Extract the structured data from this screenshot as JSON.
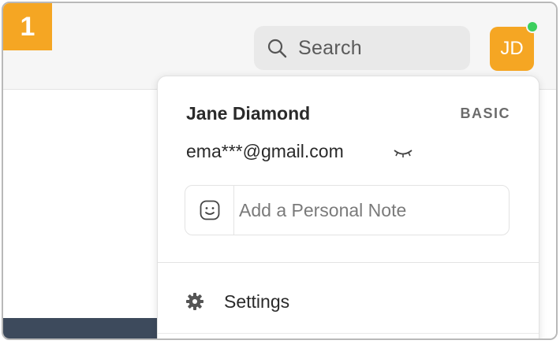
{
  "step": {
    "number": "1",
    "color": "#f5a623"
  },
  "header": {
    "search_label": "Search",
    "search_icon": "search-icon",
    "avatar_initials": "JD",
    "avatar_color": "#f5a623",
    "presence_color": "#3ccf5e"
  },
  "profile_menu": {
    "user_name": "Jane Diamond",
    "plan": "BASIC",
    "email": "ema***@gmail.com",
    "email_toggle_icon": "eye-closed-icon",
    "note_placeholder": "Add a Personal Note",
    "note_icon": "smiley-icon",
    "items": [
      {
        "label": "Settings",
        "icon": "gear-icon"
      }
    ]
  }
}
